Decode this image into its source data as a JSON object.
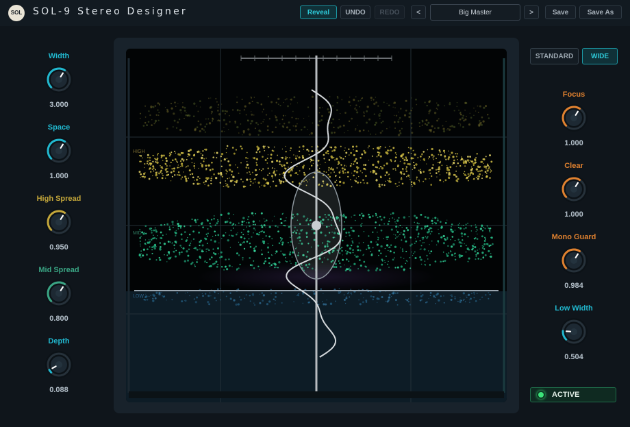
{
  "app": {
    "logo": "SOL",
    "title": "SOL-9 Stereo Designer"
  },
  "toolbar": {
    "reveal": "Reveal",
    "undo": "UNDO",
    "redo": "REDO",
    "prev": "<",
    "preset": "Big Master",
    "next": ">",
    "save": "Save",
    "save_as": "Save As"
  },
  "left_knobs": [
    {
      "label": "Width",
      "value": "3.000",
      "level": 0.62,
      "color": "#21b8cf"
    },
    {
      "label": "Space",
      "value": "1.000",
      "level": 0.62,
      "color": "#21b8cf"
    },
    {
      "label": "High Spread",
      "value": "0.950",
      "level": 0.62,
      "color": "#c4a73a"
    },
    {
      "label": "Mid Spread",
      "value": "0.800",
      "level": 0.62,
      "color": "#3aa584"
    },
    {
      "label": "Depth",
      "value": "0.088",
      "level": 0.06,
      "color": "#21b8cf"
    }
  ],
  "modes": {
    "standard": "STANDARD",
    "wide": "WIDE"
  },
  "right_knobs": [
    {
      "label": "Focus",
      "value": "1.000",
      "level": 0.62,
      "color": "#e0812f"
    },
    {
      "label": "Clear",
      "value": "1.000",
      "level": 0.62,
      "color": "#e0812f"
    },
    {
      "label": "Mono Guard",
      "value": "0.984",
      "level": 0.62,
      "color": "#e0812f"
    },
    {
      "label": "Low Width",
      "value": "0.504",
      "level": 0.18,
      "color": "#21b8cf"
    }
  ],
  "viz": {
    "bands": {
      "high": "HIGH",
      "mid": "MID",
      "low": "LOW"
    }
  },
  "status": {
    "active": "ACTIVE"
  },
  "colors": {
    "accent": "#21b8cf",
    "high": "#c4a73a",
    "mid": "#3aa584",
    "orange": "#e0812f",
    "active": "#3ce37a"
  }
}
